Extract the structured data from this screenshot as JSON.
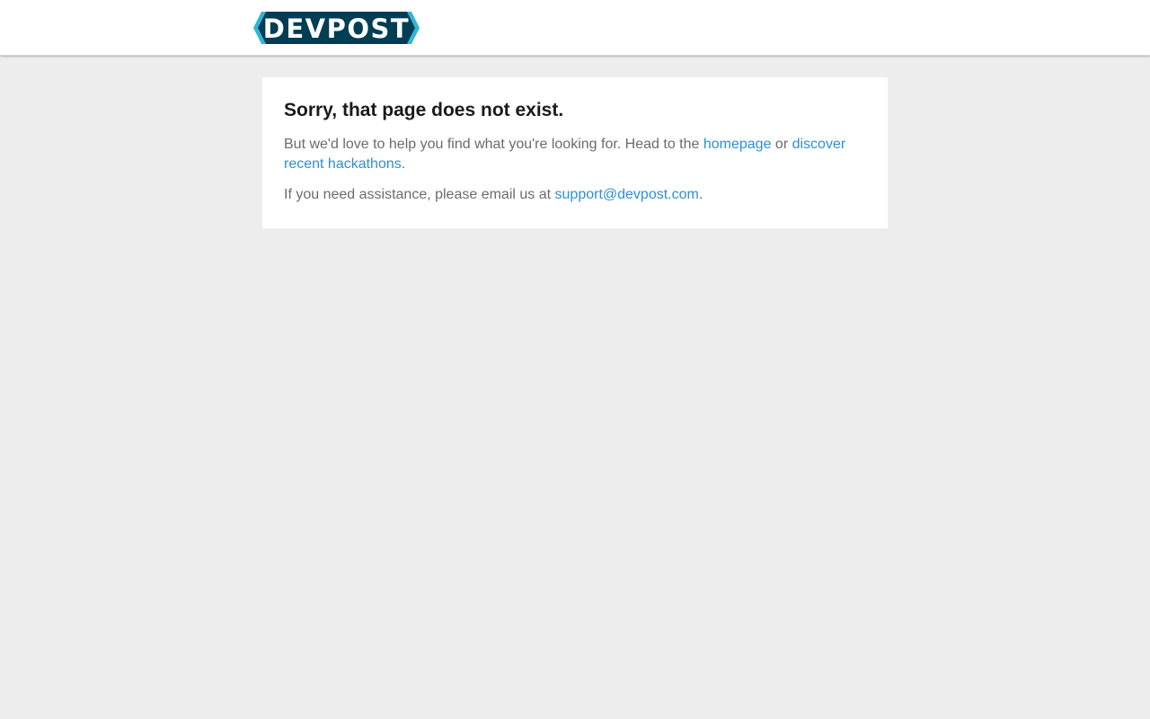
{
  "header": {
    "logo_text": "DEVPOST",
    "colors": {
      "logo_dark": "#003e54",
      "logo_accent": "#2fb6d9"
    }
  },
  "error": {
    "title": "Sorry, that page does not exist.",
    "p1_before": "But we'd love to help you find what you're looking for. Head to the ",
    "homepage_link": "homepage",
    "p1_middle": " or ",
    "discover_link": "discover recent hackathons",
    "p1_after": ".",
    "p2_before": "If you need assistance, please email us at ",
    "support_email": "support@devpost.com",
    "p2_after": "."
  },
  "colors": {
    "page_background": "#ededed",
    "card_background": "#ffffff",
    "link": "#2d8fd5",
    "body_text": "#6b6b6b",
    "heading_text": "#1a1a1a"
  }
}
